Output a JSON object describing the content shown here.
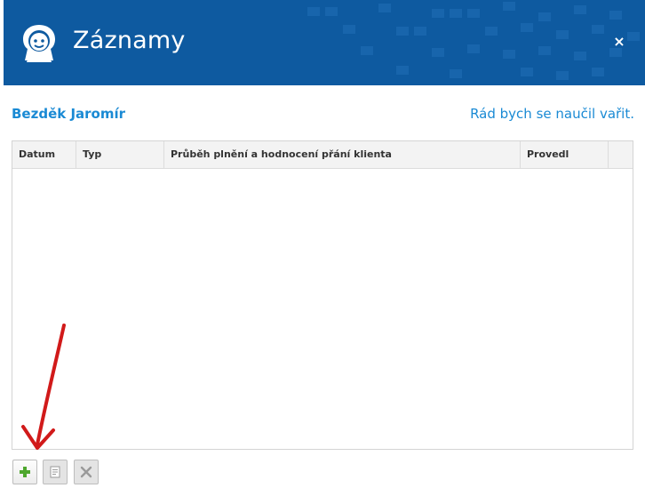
{
  "window": {
    "title": "Záznamy",
    "close_label": "×"
  },
  "client": {
    "name": "Bezděk Jaromír",
    "wish": "Rád bych se naučil vařit."
  },
  "table": {
    "columns": [
      "Datum",
      "Typ",
      "Průběh plnění a hodnocení přání klienta",
      "Provedl",
      ""
    ],
    "rows": []
  },
  "toolbar": {
    "buttons": [
      {
        "name": "add",
        "icon": "plus-icon",
        "enabled": true,
        "color": "#4ea72e"
      },
      {
        "name": "edit",
        "icon": "document-icon",
        "enabled": false
      },
      {
        "name": "delete",
        "icon": "close-x-icon",
        "enabled": false
      }
    ]
  },
  "colors": {
    "header_bg": "#0e5aa0",
    "accent": "#1a8ad4",
    "annotation_arrow": "#d11a1a"
  }
}
